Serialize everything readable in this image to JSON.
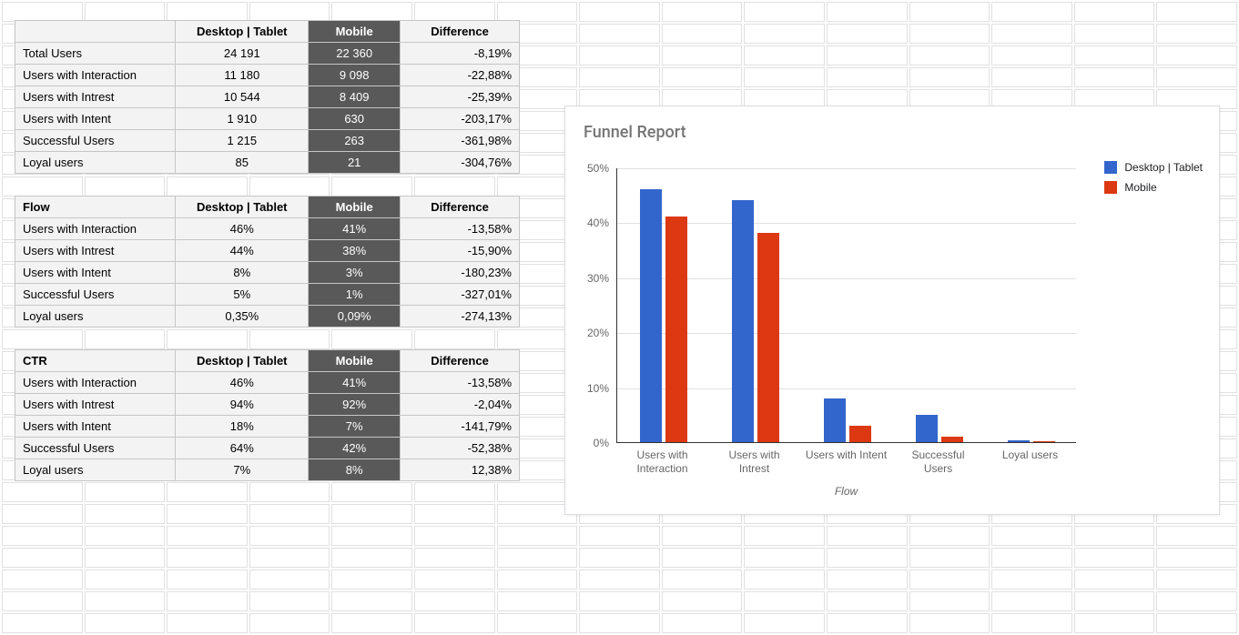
{
  "columns": {
    "desktop_tablet": "Desktop | Tablet",
    "mobile": "Mobile",
    "difference": "Difference"
  },
  "tables": {
    "absolute": {
      "title": "",
      "rows": [
        {
          "label": "Total Users",
          "desktop": "24 191",
          "mobile": "22 360",
          "diff": "-8,19%"
        },
        {
          "label": "Users with Interaction",
          "desktop": "11 180",
          "mobile": "9 098",
          "diff": "-22,88%"
        },
        {
          "label": "Users with Intrest",
          "desktop": "10 544",
          "mobile": "8 409",
          "diff": "-25,39%"
        },
        {
          "label": "Users with Intent",
          "desktop": "1 910",
          "mobile": "630",
          "diff": "-203,17%"
        },
        {
          "label": "Successful Users",
          "desktop": "1 215",
          "mobile": "263",
          "diff": "-361,98%"
        },
        {
          "label": "Loyal users",
          "desktop": "85",
          "mobile": "21",
          "diff": "-304,76%"
        }
      ]
    },
    "flow": {
      "title": "Flow",
      "rows": [
        {
          "label": "Users with Interaction",
          "desktop": "46%",
          "mobile": "41%",
          "diff": "-13,58%"
        },
        {
          "label": "Users with Intrest",
          "desktop": "44%",
          "mobile": "38%",
          "diff": "-15,90%"
        },
        {
          "label": "Users with Intent",
          "desktop": "8%",
          "mobile": "3%",
          "diff": "-180,23%"
        },
        {
          "label": "Successful Users",
          "desktop": "5%",
          "mobile": "1%",
          "diff": "-327,01%"
        },
        {
          "label": "Loyal users",
          "desktop": "0,35%",
          "mobile": "0,09%",
          "diff": "-274,13%"
        }
      ]
    },
    "ctr": {
      "title": "CTR",
      "rows": [
        {
          "label": "Users with Interaction",
          "desktop": "46%",
          "mobile": "41%",
          "diff": "-13,58%"
        },
        {
          "label": "Users with Intrest",
          "desktop": "94%",
          "mobile": "92%",
          "diff": "-2,04%"
        },
        {
          "label": "Users with Intent",
          "desktop": "18%",
          "mobile": "7%",
          "diff": "-141,79%"
        },
        {
          "label": "Successful Users",
          "desktop": "64%",
          "mobile": "42%",
          "diff": "-52,38%"
        },
        {
          "label": "Loyal users",
          "desktop": "7%",
          "mobile": "8%",
          "diff": "12,38%"
        }
      ]
    }
  },
  "chart": {
    "title": "Funnel Report",
    "xlabel": "Flow",
    "legend": {
      "desktop_tablet": "Desktop | Tablet",
      "mobile": "Mobile"
    },
    "yticks": [
      "0%",
      "10%",
      "20%",
      "30%",
      "40%",
      "50%"
    ]
  },
  "chart_data": {
    "type": "bar",
    "title": "Funnel Report",
    "xlabel": "Flow",
    "ylabel": "",
    "ylim": [
      0,
      50
    ],
    "categories": [
      "Users with Interaction",
      "Users with Intrest",
      "Users with Intent",
      "Successful Users",
      "Loyal users"
    ],
    "series": [
      {
        "name": "Desktop | Tablet",
        "color": "#3366cc",
        "values": [
          46,
          44,
          8,
          5,
          0.35
        ]
      },
      {
        "name": "Mobile",
        "color": "#dc3912",
        "values": [
          41,
          38,
          3,
          1,
          0.09
        ]
      }
    ]
  }
}
